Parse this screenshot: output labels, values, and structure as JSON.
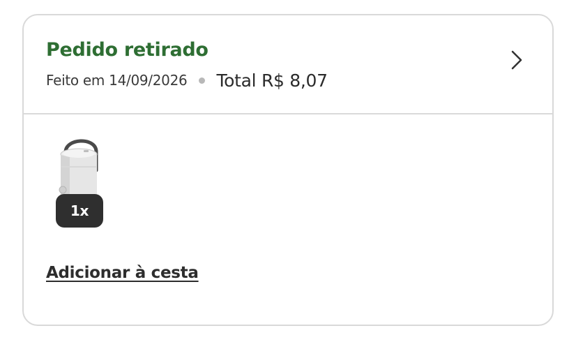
{
  "order": {
    "status": "Pedido retirado",
    "date_label": "Feito em 14/09/2026",
    "total_label": "Total R$ 8,07",
    "chevron_icon": "chevron-right-icon"
  },
  "items": [
    {
      "icon": "water-cooler-jug",
      "quantity": "1x"
    }
  ],
  "actions": {
    "add_to_basket": "Adicionar à cesta"
  },
  "colors": {
    "status": "#2e6e33",
    "border": "#d9d9d9",
    "badge": "#2f2f2f"
  }
}
